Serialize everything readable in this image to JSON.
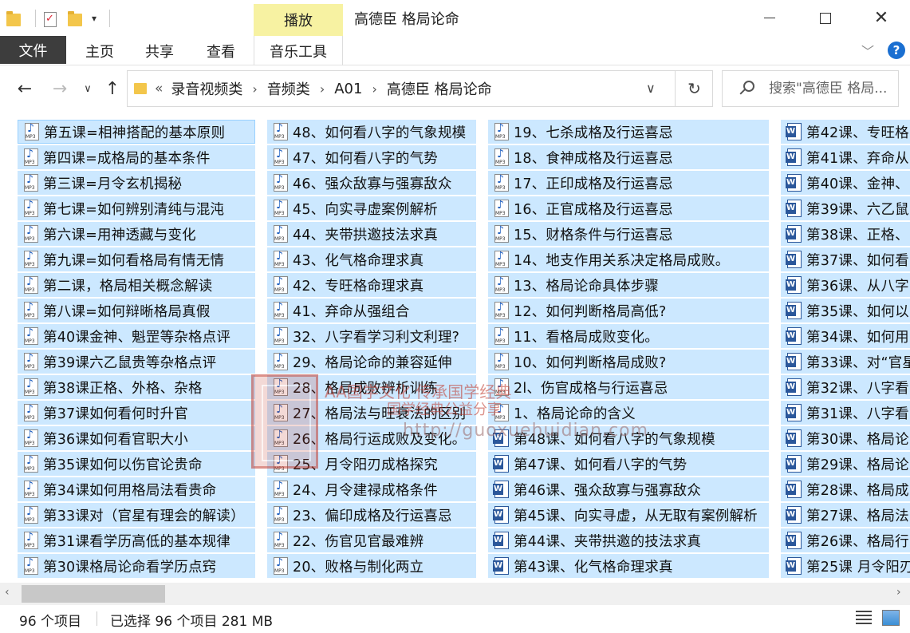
{
  "window": {
    "title": "高德臣 格局论命",
    "context_tab": "播放"
  },
  "ribbon": {
    "tabs": [
      "文件",
      "主页",
      "共享",
      "查看",
      "音乐工具"
    ],
    "help": "?"
  },
  "address": {
    "crumbs": [
      "录音视频类",
      "音频类",
      "A01",
      "高德臣 格局论命"
    ],
    "lead": "«",
    "search_placeholder": "搜索\"高德臣 格局..."
  },
  "files": {
    "col1": [
      {
        "type": "mp3",
        "name": "第五课=相神搭配的基本原则"
      },
      {
        "type": "mp3",
        "name": "第四课=成格局的基本条件"
      },
      {
        "type": "mp3",
        "name": "第三课=月令玄机揭秘"
      },
      {
        "type": "mp3",
        "name": "第七课=如何辨别清纯与混沌"
      },
      {
        "type": "mp3",
        "name": "第六课=用神透藏与变化"
      },
      {
        "type": "mp3",
        "name": "第九课=如何看格局有情无情"
      },
      {
        "type": "mp3",
        "name": "第二课，格局相关概念解读"
      },
      {
        "type": "mp3",
        "name": "第八课=如何辩晰格局真假"
      },
      {
        "type": "mp3",
        "name": "第40课金神、魁罡等杂格点评"
      },
      {
        "type": "mp3",
        "name": "第39课六乙鼠贵等杂格点评"
      },
      {
        "type": "mp3",
        "name": "第38课正格、外格、杂格"
      },
      {
        "type": "mp3",
        "name": "第37课如何看何时升官"
      },
      {
        "type": "mp3",
        "name": "第36课如何看官职大小"
      },
      {
        "type": "mp3",
        "name": "第35课如何以伤官论贵命"
      },
      {
        "type": "mp3",
        "name": "第34课如何用格局法看贵命"
      },
      {
        "type": "mp3",
        "name": "第33课对（官星有理会的解读）"
      },
      {
        "type": "mp3",
        "name": "第31课看学历高低的基本规律"
      },
      {
        "type": "mp3",
        "name": "第30课格局论命看学历点窍"
      }
    ],
    "col2": [
      {
        "type": "mp3",
        "name": "48、如何看八字的气象规模"
      },
      {
        "type": "mp3",
        "name": "47、如何看八字的气势"
      },
      {
        "type": "mp3",
        "name": "46、强众敌寡与强寡敌众"
      },
      {
        "type": "mp3",
        "name": "45、向实寻虚案例解析"
      },
      {
        "type": "mp3",
        "name": "44、夹带拱邀技法求真"
      },
      {
        "type": "mp3",
        "name": "43、化气格命理求真"
      },
      {
        "type": "mp3",
        "name": "42、专旺格命理求真"
      },
      {
        "type": "mp3",
        "name": "41、弃命从强组合"
      },
      {
        "type": "mp3",
        "name": "32、八字看学习利文利理?"
      },
      {
        "type": "mp3",
        "name": "29、格局论命的兼容延伸"
      },
      {
        "type": "mp3",
        "name": "28、格局成败辨析训练"
      },
      {
        "type": "mp3",
        "name": "27、格局法与旺衰法的区别"
      },
      {
        "type": "mp3",
        "name": "26、格局行运成败及变化。"
      },
      {
        "type": "mp3",
        "name": "25、月令阳刃成格探究"
      },
      {
        "type": "mp3",
        "name": "24、月令建禄成格条件"
      },
      {
        "type": "mp3",
        "name": "23、偏印成格及行运喜忌"
      },
      {
        "type": "mp3",
        "name": "22、伤官见官最难辨"
      },
      {
        "type": "mp3",
        "name": "20、败格与制化两立"
      }
    ],
    "col3": [
      {
        "type": "mp3",
        "name": "19、七杀成格及行运喜忌"
      },
      {
        "type": "mp3",
        "name": "18、食神成格及行运喜忌"
      },
      {
        "type": "mp3",
        "name": "17、正印成格及行运喜忌"
      },
      {
        "type": "mp3",
        "name": "16、正官成格及行运喜忌"
      },
      {
        "type": "mp3",
        "name": "15、财格条件与行运喜忌"
      },
      {
        "type": "mp3",
        "name": "14、地支作用关系决定格局成败。"
      },
      {
        "type": "mp3",
        "name": "13、格局论命具体步骤"
      },
      {
        "type": "mp3",
        "name": "12、如何判断格局高低?"
      },
      {
        "type": "mp3",
        "name": "11、看格局成败变化。"
      },
      {
        "type": "mp3",
        "name": "10、如何判断格局成败?"
      },
      {
        "type": "mp3",
        "name": "2l、伤官成格与行运喜忌"
      },
      {
        "type": "mp3",
        "name": "1、格局论命的含义"
      },
      {
        "type": "doc",
        "name": "第48课、如何看八字的气象规模"
      },
      {
        "type": "doc",
        "name": "第47课、如何看八字的气势"
      },
      {
        "type": "doc",
        "name": "第46课、强众敌寡与强寡敌众"
      },
      {
        "type": "doc",
        "name": "第45课、向实寻虚，从无取有案例解析"
      },
      {
        "type": "doc",
        "name": "第44课、夹带拱邀的技法求真"
      },
      {
        "type": "doc",
        "name": "第43课、化气格命理求真"
      }
    ],
    "col4": [
      {
        "type": "doc",
        "name": "第42课、专旺格"
      },
      {
        "type": "doc",
        "name": "第41课、弃命从"
      },
      {
        "type": "doc",
        "name": "第40课、金神、"
      },
      {
        "type": "doc",
        "name": "第39课、六乙鼠"
      },
      {
        "type": "doc",
        "name": "第38课、正格、"
      },
      {
        "type": "doc",
        "name": "第37课、如何看"
      },
      {
        "type": "doc",
        "name": "第36课、从八字"
      },
      {
        "type": "doc",
        "name": "第35课、如何以"
      },
      {
        "type": "doc",
        "name": "第34课、如何用"
      },
      {
        "type": "doc",
        "name": "第33课、对“官星"
      },
      {
        "type": "doc",
        "name": "第32课、八字看"
      },
      {
        "type": "doc",
        "name": "第31课、八字看"
      },
      {
        "type": "doc",
        "name": "第30课、格局论"
      },
      {
        "type": "doc",
        "name": "第29课、格局论"
      },
      {
        "type": "doc",
        "name": "第28课、格局成"
      },
      {
        "type": "doc",
        "name": "第27课、格局法"
      },
      {
        "type": "doc",
        "name": "第26课、格局行"
      },
      {
        "type": "doc",
        "name": "第25课 月令阳刃"
      }
    ]
  },
  "watermark": {
    "line1": "AA国学文化 传承国学经典",
    "line2": "国学经典公益分享",
    "url": "http://guoxuehuidian.com"
  },
  "status": {
    "count": "96 个项目",
    "selection": "已选择 96 个项目  281 MB"
  },
  "icons": {
    "back": "arrow-left-icon",
    "forward": "arrow-right-icon",
    "up": "arrow-up-icon",
    "refresh": "refresh-icon",
    "search": "search-icon"
  },
  "colors": {
    "selection": "#cce8ff",
    "context_tab": "#f7f2a2",
    "file_tab": "#3d3d3d",
    "help": "#1a6fd1"
  }
}
